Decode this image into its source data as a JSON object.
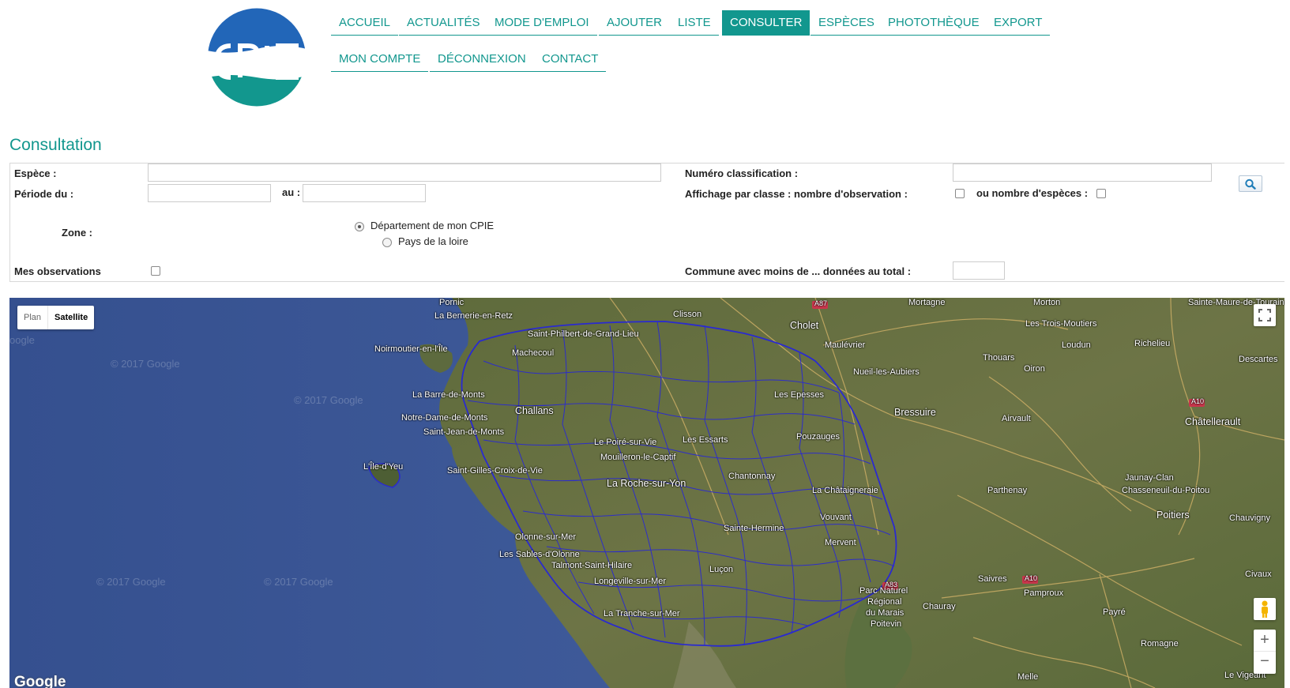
{
  "logo": {
    "text": "CPIE",
    "colors": {
      "top": "#2266b8",
      "bottom": "#12978e"
    }
  },
  "nav": {
    "row1": [
      "ACCUEIL",
      "ACTUALITÉS",
      "MODE D'EMPLOI",
      "AJOUTER",
      "LISTE",
      "CONSULTER",
      "ESPÈCES",
      "PHOTOTHÈQUE",
      "EXPORT"
    ],
    "row2": [
      "MON COMPTE",
      "DÉCONNEXION",
      "CONTACT"
    ],
    "active": "CONSULTER"
  },
  "page": {
    "title": "Consultation"
  },
  "form": {
    "espece_label": "Espèce :",
    "espece_value": "",
    "periode_label": "Période du :",
    "periode_from": "",
    "au_label": "au :",
    "periode_to": "",
    "zone_label": "Zone :",
    "zone_options": [
      {
        "label": "Département de mon CPIE",
        "checked": true
      },
      {
        "label": "Pays de la loire",
        "checked": false
      }
    ],
    "mes_obs_label": "Mes observations",
    "mes_obs_checked": false,
    "numero_label": "Numéro classification :",
    "numero_value": "",
    "affichage_label": "Affichage par classe : nombre d'observation :",
    "nb_especes_label": "ou nombre d'espèces :",
    "commune_label": "Commune avec moins de ... données au total :",
    "commune_value": "",
    "search_icon": "magnifier-icon"
  },
  "map": {
    "type_plan": "Plan",
    "type_satellite": "Satellite",
    "selected_type": "Satellite",
    "zoom_in": "+",
    "zoom_out": "−",
    "google_logo": "Google",
    "watermark": "© 2017 Google",
    "watermark_partial": "oogle",
    "roads": [
      "A87",
      "A83",
      "A10"
    ],
    "places": [
      {
        "name": "Pornic",
        "big": false
      },
      {
        "name": "La Bernerie-en-Retz",
        "big": false
      },
      {
        "name": "Clisson",
        "big": false
      },
      {
        "name": "Saint-Philbert-de-Grand-Lieu",
        "big": false
      },
      {
        "name": "Noirmoutier-en-l'Île",
        "big": false
      },
      {
        "name": "Machecoul",
        "big": false
      },
      {
        "name": "Cholet",
        "big": true
      },
      {
        "name": "Maulévrier",
        "big": false
      },
      {
        "name": "Mortagne",
        "big": false
      },
      {
        "name": "Morton",
        "big": false
      },
      {
        "name": "Les Trois-Moutiers",
        "big": false
      },
      {
        "name": "Sainte-Maure-de-Touraine",
        "big": false
      },
      {
        "name": "Loudun",
        "big": false
      },
      {
        "name": "Richelieu",
        "big": false
      },
      {
        "name": "Descartes",
        "big": false
      },
      {
        "name": "Thouars",
        "big": false
      },
      {
        "name": "Oiron",
        "big": false
      },
      {
        "name": "Nueil-les-Aubiers",
        "big": false
      },
      {
        "name": "La Barre-de-Monts",
        "big": false
      },
      {
        "name": "Challans",
        "big": true
      },
      {
        "name": "Les Epesses",
        "big": false
      },
      {
        "name": "Bressuire",
        "big": true
      },
      {
        "name": "Airvault",
        "big": false
      },
      {
        "name": "Châtellerault",
        "big": true
      },
      {
        "name": "Notre-Dame-de-Monts",
        "big": false
      },
      {
        "name": "Saint-Jean-de-Monts",
        "big": false
      },
      {
        "name": "Les Essarts",
        "big": false
      },
      {
        "name": "Pouzauges",
        "big": false
      },
      {
        "name": "Le Poiré-sur-Vie",
        "big": false
      },
      {
        "name": "L'Île-d'Yeu",
        "big": false
      },
      {
        "name": "Mouilleron-le-Captif",
        "big": false
      },
      {
        "name": "Saint-Gilles-Croix-de-Vie",
        "big": false
      },
      {
        "name": "Chantonnay",
        "big": false
      },
      {
        "name": "Jaunay-Clan",
        "big": false
      },
      {
        "name": "La Roche-sur-Yon",
        "big": true
      },
      {
        "name": "La Châtaigneraie",
        "big": false
      },
      {
        "name": "Parthenay",
        "big": false
      },
      {
        "name": "Chasseneuil-du-Poitou",
        "big": false
      },
      {
        "name": "Poitiers",
        "big": true
      },
      {
        "name": "Chauvigny",
        "big": false
      },
      {
        "name": "Vouvant",
        "big": false
      },
      {
        "name": "Sainte-Hermine",
        "big": false
      },
      {
        "name": "Olonne-sur-Mer",
        "big": false
      },
      {
        "name": "Mervent",
        "big": false
      },
      {
        "name": "Les Sables-d'Olonne",
        "big": false
      },
      {
        "name": "Talmont-Saint-Hilaire",
        "big": false
      },
      {
        "name": "Luçon",
        "big": false
      },
      {
        "name": "Longeville-sur-Mer",
        "big": false
      },
      {
        "name": "Saivres",
        "big": false
      },
      {
        "name": "Civaux",
        "big": false
      },
      {
        "name": "Parc Naturel",
        "big": false
      },
      {
        "name": "Pamproux",
        "big": false
      },
      {
        "name": "Chauray",
        "big": false
      },
      {
        "name": "Régional",
        "big": false
      },
      {
        "name": "La Tranche-sur-Mer",
        "big": false
      },
      {
        "name": "du Marais",
        "big": false
      },
      {
        "name": "Payré",
        "big": false
      },
      {
        "name": "Poitevin",
        "big": false
      },
      {
        "name": "Romagne",
        "big": false
      },
      {
        "name": "Melle",
        "big": false
      },
      {
        "name": "Le Vigeant",
        "big": false
      }
    ]
  }
}
